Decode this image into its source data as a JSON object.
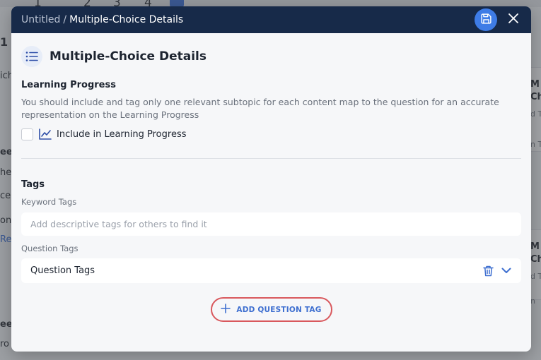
{
  "background": {
    "tab_numbers": [
      "1",
      "2",
      "3",
      "4"
    ],
    "left_fragments": [
      "1",
      "ich",
      "ee",
      "he",
      "cell",
      "one",
      "Rea",
      "ee",
      "ro"
    ],
    "right_fragments": [
      "M",
      "Ch",
      "d T",
      "n T",
      "M",
      "Ch",
      "d T",
      "n"
    ]
  },
  "header": {
    "breadcrumb_root": "Untitled",
    "breadcrumb_separator": "/",
    "breadcrumb_current": "Multiple-Choice Details",
    "save_icon": "save-icon",
    "close_icon": "close-icon"
  },
  "title": {
    "icon": "list-icon",
    "text": "Multiple-Choice Details"
  },
  "learning_progress": {
    "title": "Learning Progress",
    "description": "You should include and tag only one relevant subtopic for each content map to the question for an accurate representation on the Learning Progress",
    "checkbox_label": "Include in Learning Progress",
    "checked": false,
    "icon": "line-chart-icon"
  },
  "tags": {
    "title": "Tags",
    "keyword_label": "Keyword Tags",
    "keyword_placeholder": "Add descriptive tags for others to find it",
    "keyword_value": "",
    "question_label": "Question Tags",
    "question_value": "Question Tags",
    "delete_icon": "trash-icon",
    "expand_icon": "chevron-down-icon"
  },
  "add_button": {
    "label": "ADD QUESTION TAG",
    "icon": "plus-icon"
  },
  "colors": {
    "header_bg": "#172a49",
    "accent": "#3e7ce6",
    "highlight_ring": "#d9585d"
  }
}
